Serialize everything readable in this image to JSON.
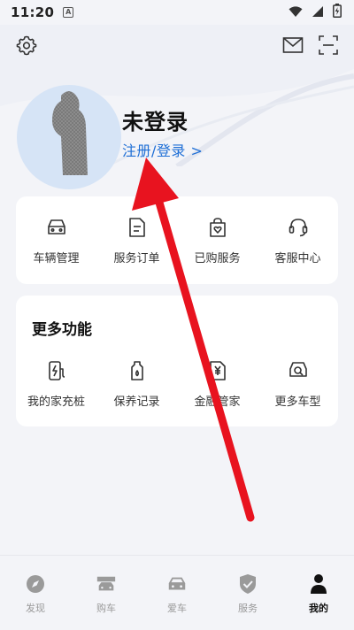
{
  "status_bar": {
    "time": "11:20",
    "notif_letter": "A"
  },
  "profile": {
    "title": "未登录",
    "login_link": "注册/登录 >"
  },
  "quick_menu": [
    {
      "label": "车辆管理",
      "icon": "car-icon"
    },
    {
      "label": "服务订单",
      "icon": "order-icon"
    },
    {
      "label": "已购服务",
      "icon": "shopping-bag-icon"
    },
    {
      "label": "客服中心",
      "icon": "headset-icon"
    }
  ],
  "more": {
    "title": "更多功能",
    "items": [
      {
        "label": "我的家充桩",
        "icon": "charger-icon"
      },
      {
        "label": "保养记录",
        "icon": "oil-bottle-icon"
      },
      {
        "label": "金融管家",
        "icon": "yuan-document-icon"
      },
      {
        "label": "更多车型",
        "icon": "car-search-icon"
      }
    ]
  },
  "tabs": [
    {
      "label": "发现",
      "icon": "compass-icon"
    },
    {
      "label": "购车",
      "icon": "car-showroom-icon"
    },
    {
      "label": "爱车",
      "icon": "my-car-icon"
    },
    {
      "label": "服务",
      "icon": "shield-check-icon"
    },
    {
      "label": "我的",
      "icon": "person-icon",
      "active": true
    }
  ],
  "colors": {
    "accent": "#1f6fd6",
    "annotation_arrow": "#e8131f",
    "avatar_bg": "#d6e4f6"
  }
}
